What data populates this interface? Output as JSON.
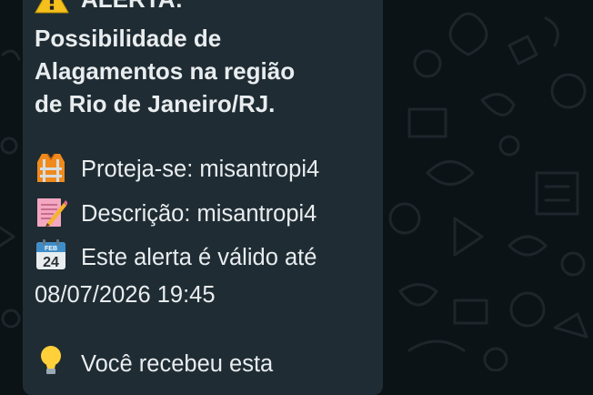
{
  "message": {
    "title": "⚠️ ALERTA:",
    "headline_lines": [
      "Possibilidade de",
      "Alagamentos na região",
      "de Rio de Janeiro/RJ."
    ],
    "protect_text": "Proteja-se: misantropi4",
    "description_text": "Descrição: misantropi4",
    "validity_line1": "Este alerta é válido até",
    "validity_line2": "08/07/2026 19:45",
    "received_text": "Você recebeu esta",
    "calendar_month": "FEB",
    "calendar_day": "24"
  },
  "icons": {
    "warning": "warning-icon",
    "vest": "safety-vest-icon",
    "memo": "memo-icon",
    "calendar": "calendar-icon",
    "bulb": "light-bulb-icon"
  },
  "colors": {
    "chat_background": "#0c1317",
    "bubble_background": "#1f2c33",
    "text": "#e9edef"
  }
}
